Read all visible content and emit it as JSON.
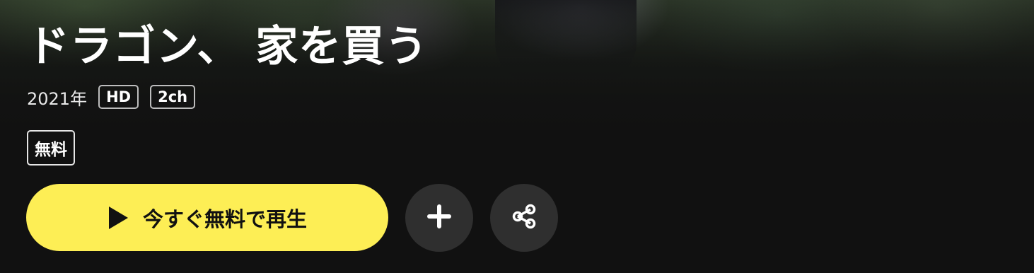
{
  "title": "ドラゴン、 家を買う",
  "meta": {
    "year": "2021年",
    "tags": [
      "HD",
      "2ch"
    ]
  },
  "badge": "無料",
  "actions": {
    "play_label": "今すぐ無料で再生",
    "play_icon": "play-icon",
    "add_icon": "plus-icon",
    "share_icon": "share-icon"
  },
  "colors": {
    "background": "#111111",
    "play_button": "#fdee55",
    "circle_button": "#2f2f2f"
  }
}
